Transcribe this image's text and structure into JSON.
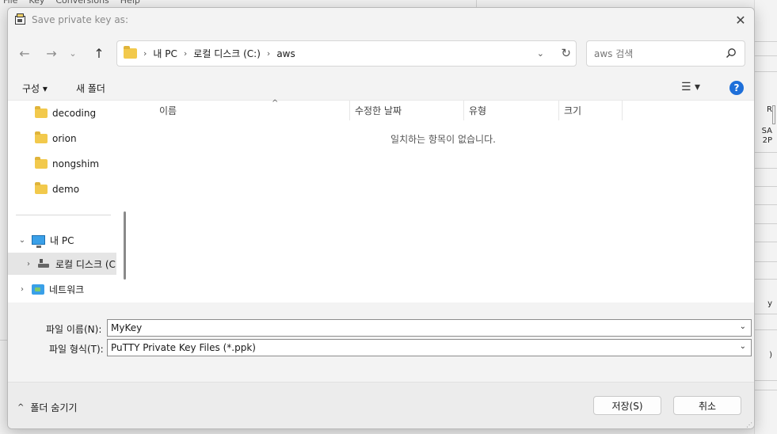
{
  "background_app": {
    "menu": [
      "File",
      "Key",
      "Conversions",
      "Help"
    ],
    "right_fragments": [
      "R",
      "SA",
      "2P",
      "y",
      ")"
    ]
  },
  "dialog": {
    "title": "Save private key as:"
  },
  "navigation": {
    "breadcrumb": [
      "내 PC",
      "로컬 디스크 (C:)",
      "aws"
    ],
    "search_placeholder": "aws 검색"
  },
  "command_bar": {
    "organize_label": "구성 ▾",
    "new_folder_label": "새 폴더"
  },
  "sidebar": {
    "folders": [
      "decoding",
      "orion",
      "nongshim",
      "demo"
    ],
    "this_pc": "내 PC",
    "local_disk": "로컬 디스크 (C",
    "network": "네트워크"
  },
  "file_list": {
    "columns": [
      "이름",
      "수정한 날짜",
      "유형",
      "크기"
    ],
    "empty_message": "일치하는 항목이 없습니다."
  },
  "form": {
    "filename_label": "파일 이름(N):",
    "filename_value": "MyKey",
    "filetype_label": "파일 형식(T):",
    "filetype_value": "PuTTY Private Key Files (*.ppk)"
  },
  "footer": {
    "hide_folders_label": "폴더 숨기기",
    "save_label": "저장(S)",
    "cancel_label": "취소"
  },
  "colors": {
    "help_icon": "#1e6fd9",
    "folder": "#f2c94c",
    "selected_row": "#e5e5e5"
  }
}
